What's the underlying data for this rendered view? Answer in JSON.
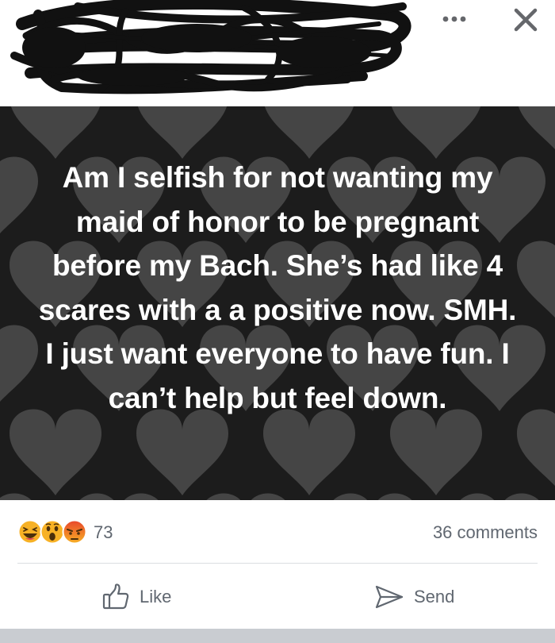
{
  "post": {
    "text": "Am I selfish for not wanting my maid of honor to be pregnant before my Bach. She’s had like 4 scares with a a positive now.  SMH. I just want everyone to have fun. I can’t help but feel down."
  },
  "reactions": {
    "icons": [
      "haha-icon",
      "wow-icon",
      "angry-icon"
    ],
    "count": "73",
    "comments": "36 comments"
  },
  "actions": {
    "like_label": "Like",
    "send_label": "Send"
  },
  "header": {
    "more_icon": "more-horizontal-icon",
    "close_icon": "close-icon"
  },
  "colors": {
    "post_background": "#1c1c1c",
    "heart": "#4a4a4a",
    "secondary_text": "#606770",
    "divider": "#dadde1"
  }
}
